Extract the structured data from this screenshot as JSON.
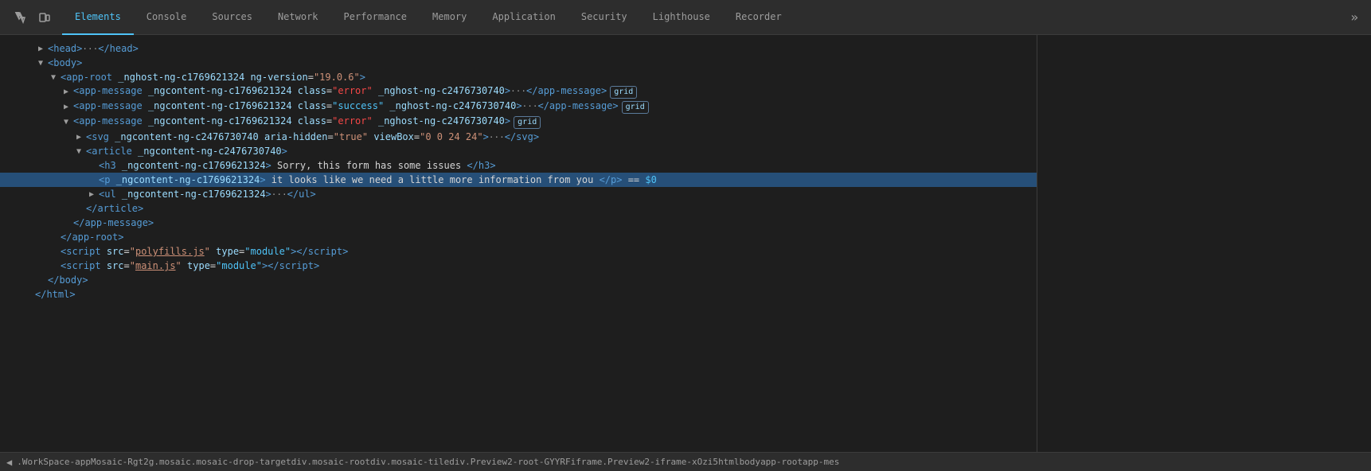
{
  "tabs": [
    {
      "id": "elements",
      "label": "Elements",
      "active": true
    },
    {
      "id": "console",
      "label": "Console",
      "active": false
    },
    {
      "id": "sources",
      "label": "Sources",
      "active": false
    },
    {
      "id": "network",
      "label": "Network",
      "active": false
    },
    {
      "id": "performance",
      "label": "Performance",
      "active": false
    },
    {
      "id": "memory",
      "label": "Memory",
      "active": false
    },
    {
      "id": "application",
      "label": "Application",
      "active": false
    },
    {
      "id": "security",
      "label": "Security",
      "active": false
    },
    {
      "id": "lighthouse",
      "label": "Lighthouse",
      "active": false
    },
    {
      "id": "recorder",
      "label": "Recorder",
      "active": false
    }
  ],
  "dom_lines": [
    {
      "id": 1,
      "indent": 3,
      "triangle": "closed",
      "html": "<span class='tag'>&lt;head&gt;</span><span class='ellipsis'>···</span><span class='tag'>&lt;/head&gt;</span>",
      "selected": false
    },
    {
      "id": 2,
      "indent": 3,
      "triangle": "open",
      "html": "<span class='tag'>&lt;body&gt;</span>",
      "selected": false
    },
    {
      "id": 3,
      "indent": 4,
      "triangle": "open",
      "html": "<span class='tag'>&lt;app-root</span> <span class='attr-name'>_nghost-ng-c1769621324</span> <span class='attr-name'>ng-version</span>=<span class='attr-value-orange'>\"19.0.6\"</span><span class='tag'>&gt;</span>",
      "selected": false
    },
    {
      "id": 4,
      "indent": 5,
      "triangle": "closed",
      "html": "<span class='tag'>&lt;app-message</span> <span class='attr-name'>_ngcontent-ng-c1769621324</span> <span class='attr-name'>class</span>=<span class='attr-value-red'>\"error\"</span> <span class='attr-name'>_nghost-ng-c2476730740</span><span class='tag'>&gt;</span><span class='ellipsis'>···</span><span class='tag'>&lt;/app-message&gt;</span><span class='badge'>grid</span>",
      "selected": false
    },
    {
      "id": 5,
      "indent": 5,
      "triangle": "closed",
      "html": "<span class='tag'>&lt;app-message</span> <span class='attr-name'>_ngcontent-ng-c1769621324</span> <span class='attr-name'>class</span>=<span class='attr-value-blue'>\"success\"</span> <span class='attr-name'>_nghost-ng-c2476730740</span><span class='tag'>&gt;</span><span class='ellipsis'>···</span><span class='tag'>&lt;/app-message&gt;</span><span class='badge'>grid</span>",
      "selected": false
    },
    {
      "id": 6,
      "indent": 5,
      "triangle": "open",
      "html": "<span class='tag'>&lt;app-message</span> <span class='attr-name'>_ngcontent-ng-c1769621324</span> <span class='attr-name'>class</span>=<span class='attr-value-red'>\"error\"</span> <span class='attr-name'>_nghost-ng-c2476730740</span><span class='tag'>&gt;</span><span class='badge'>grid</span>",
      "selected": false
    },
    {
      "id": 7,
      "indent": 6,
      "triangle": "closed",
      "html": "<span class='tag'>&lt;svg</span> <span class='attr-name'>_ngcontent-ng-c2476730740</span> <span class='attr-name'>aria-hidden</span>=<span class='attr-value-orange'>\"true\"</span> <span class='attr-name'>viewBox</span>=<span class='attr-value-orange'>\"0 0 24 24\"</span><span class='tag'>&gt;</span><span class='ellipsis'>···</span><span class='tag'>&lt;/svg&gt;</span>",
      "selected": false
    },
    {
      "id": 8,
      "indent": 6,
      "triangle": "open",
      "html": "<span class='tag'>&lt;article</span> <span class='attr-name'>_ngcontent-ng-c2476730740</span><span class='tag'>&gt;</span>",
      "selected": false
    },
    {
      "id": 9,
      "indent": 7,
      "triangle": "none",
      "html": "<span class='tag'>&lt;h3</span> <span class='attr-name'>_ngcontent-ng-c1769621324</span><span class='tag'>&gt;</span><span class='text-content'> Sorry, this form has some issues </span><span class='tag'>&lt;/h3&gt;</span>",
      "selected": false
    },
    {
      "id": 10,
      "indent": 7,
      "triangle": "none",
      "html": "<span class='tag'>&lt;p</span> <span class='attr-name'>_ngcontent-ng-c1769621324</span><span class='tag'>&gt;</span><span class='text-content'> it looks like we need a little more information from you </span><span class='tag'>&lt;/p&gt;</span><span class='text-content'> == <span style='color:#4fc3f7'>$0</span></span>",
      "selected": true
    },
    {
      "id": 11,
      "indent": 7,
      "triangle": "closed",
      "html": "<span class='tag'>&lt;ul</span> <span class='attr-name'>_ngcontent-ng-c1769621324</span><span class='tag'>&gt;</span><span class='ellipsis'>···</span><span class='tag'>&lt;/ul&gt;</span>",
      "selected": false
    },
    {
      "id": 12,
      "indent": 6,
      "triangle": "none",
      "html": "<span class='tag'>&lt;/article&gt;</span>",
      "selected": false
    },
    {
      "id": 13,
      "indent": 5,
      "triangle": "none",
      "html": "<span class='tag'>&lt;/app-message&gt;</span>",
      "selected": false
    },
    {
      "id": 14,
      "indent": 4,
      "triangle": "none",
      "html": "<span class='tag'>&lt;/app-root&gt;</span>",
      "selected": false
    },
    {
      "id": 15,
      "indent": 4,
      "triangle": "none",
      "html": "<span class='tag'>&lt;script</span> <span class='attr-name'>src</span>=<span class='attr-value-string'>\"<span style='text-decoration:underline;color:#ce9178'>polyfills.js</span>\"</span> <span class='attr-name'>type</span>=<span class='attr-value-blue'>\"module\"</span><span class='tag'>&gt;&lt;/script&gt;</span>",
      "selected": false
    },
    {
      "id": 16,
      "indent": 4,
      "triangle": "none",
      "html": "<span class='tag'>&lt;script</span> <span class='attr-name'>src</span>=<span class='attr-value-string'>\"<span style='text-decoration:underline;color:#ce9178'>main.js</span>\"</span> <span class='attr-name'>type</span>=<span class='attr-value-blue'>\"module\"</span><span class='tag'>&gt;&lt;/script&gt;</span>",
      "selected": false
    },
    {
      "id": 17,
      "indent": 3,
      "triangle": "none",
      "html": "<span class='tag'>&lt;/body&gt;</span>",
      "selected": false
    },
    {
      "id": 18,
      "indent": 2,
      "triangle": "none",
      "html": "<span class='tag'>&lt;/html&gt;</span>",
      "selected": false
    }
  ],
  "status_bar": {
    "items": [
      ".WorkSpace-appMosaic-Rgt2g.mosaic.mosaic-drop-target",
      "div.mosaic-root",
      "div.mosaic-tile",
      "div.Preview2-root-GYYRF",
      "iframe.Preview2-iframe-xOzi5",
      "html",
      "body",
      "app-root",
      "app-mes"
    ]
  },
  "colors": {
    "tab_active_color": "#4fc3f7",
    "selected_bg": "#264f78",
    "tag_color": "#569cd6",
    "attr_name_color": "#9cdcfe",
    "attr_value_orange": "#ce9178",
    "attr_value_blue": "#4fc3f7"
  }
}
